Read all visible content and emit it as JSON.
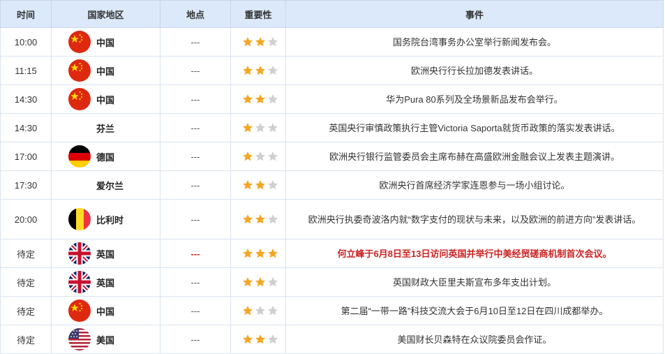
{
  "headers": {
    "time": "时间",
    "region": "国家地区",
    "location": "地点",
    "importance": "重要性",
    "event": "事件"
  },
  "colors": {
    "header_bg": "#dbe9fa",
    "star_on": "#f5a623",
    "star_off": "#cfcfcf",
    "highlight": "#cc2222"
  },
  "rows": [
    {
      "time": "10:00",
      "flag": "china-flag-icon",
      "region": "中国",
      "location": "---",
      "stars": 2,
      "event": "国务院台湾事务办公室举行新闻发布会。",
      "highlight": false,
      "tall": false
    },
    {
      "time": "11:15",
      "flag": "china-flag-icon",
      "region": "中国",
      "location": "---",
      "stars": 2,
      "event": "欧洲央行行长拉加德发表讲话。",
      "highlight": false,
      "tall": false
    },
    {
      "time": "14:30",
      "flag": "china-flag-icon",
      "region": "中国",
      "location": "---",
      "stars": 2,
      "event": "华为Pura 80系列及全场景新品发布会举行。",
      "highlight": false,
      "tall": false
    },
    {
      "time": "14:30",
      "flag": "",
      "region": "芬兰",
      "location": "---",
      "stars": 1,
      "event": "英国央行审慎政策执行主管Victoria Saporta就货币政策的落实发表讲话。",
      "highlight": false,
      "tall": false
    },
    {
      "time": "17:00",
      "flag": "germany-flag-icon",
      "region": "德国",
      "location": "---",
      "stars": 1,
      "event": "欧洲央行银行监管委员会主席布赫在高盛欧洲金融会议上发表主题演讲。",
      "highlight": false,
      "tall": false
    },
    {
      "time": "17:30",
      "flag": "",
      "region": "爱尔兰",
      "location": "---",
      "stars": 2,
      "event": "欧洲央行首席经济学家连恩参与一场小组讨论。",
      "highlight": false,
      "tall": false
    },
    {
      "time": "20:00",
      "flag": "belgium-flag-icon",
      "region": "比利时",
      "location": "---",
      "stars": 2,
      "event": "欧洲央行执委奇波洛内就“数字支付的现状与未来，以及欧洲的前进方向”发表讲话。",
      "highlight": false,
      "tall": true
    },
    {
      "time": "待定",
      "flag": "uk-flag-icon",
      "region": "英国",
      "location": "---",
      "stars": 3,
      "event": "何立峰于6月8日至13日访问英国并举行中美经贸磋商机制首次会议。",
      "highlight": true,
      "tall": false
    },
    {
      "time": "待定",
      "flag": "uk-flag-icon",
      "region": "英国",
      "location": "---",
      "stars": 2,
      "event": "英国财政大臣里夫斯宣布多年支出计划。",
      "highlight": false,
      "tall": false
    },
    {
      "time": "待定",
      "flag": "china-flag-icon",
      "region": "中国",
      "location": "---",
      "stars": 1,
      "event": "第二届“一带一路”科技交流大会于6月10日至12日在四川成都举办。",
      "highlight": false,
      "tall": false
    },
    {
      "time": "待定",
      "flag": "usa-flag-icon",
      "region": "美国",
      "location": "---",
      "stars": 2,
      "event": "美国财长贝森特在众议院委员会作证。",
      "highlight": false,
      "tall": false
    }
  ]
}
